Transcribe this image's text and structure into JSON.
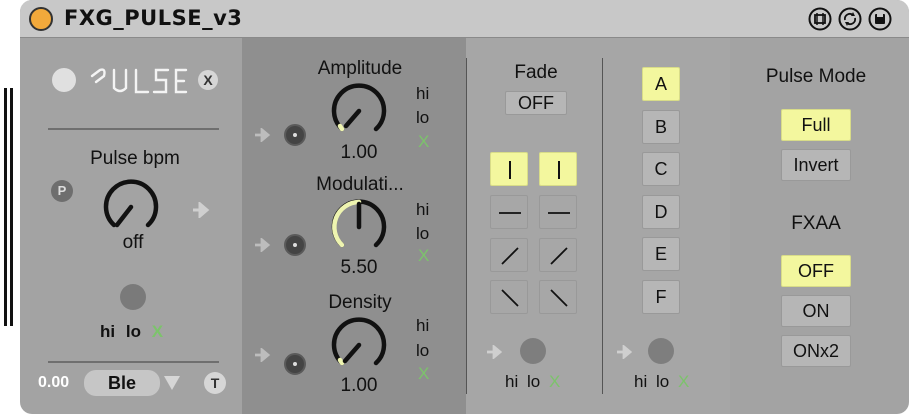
{
  "title": "FXG_PULSE_v3",
  "logo_text": "PULSE",
  "header_icons": [
    "freeze-icon",
    "reload-icon",
    "save-icon"
  ],
  "left": {
    "close_label": "X",
    "pulse_bpm_label": "Pulse bpm",
    "p_button": "P",
    "pulse_bpm_value": "off",
    "hi": "hi",
    "lo": "lo",
    "x": "X",
    "bottom_value": "0.00",
    "bottom_select": "Ble",
    "t_button": "T"
  },
  "knobs": [
    {
      "label": "Amplitude",
      "value": "1.00",
      "hi": "hi",
      "lo": "lo",
      "x": "X"
    },
    {
      "label": "Modulati...",
      "value": "5.50",
      "hi": "hi",
      "lo": "lo",
      "x": "X"
    },
    {
      "label": "Density",
      "value": "1.00",
      "hi": "hi",
      "lo": "lo",
      "x": "X"
    }
  ],
  "fade": {
    "label": "Fade",
    "value": "OFF",
    "hi": "hi",
    "lo": "lo",
    "x": "X"
  },
  "letters": {
    "items": [
      "A",
      "B",
      "C",
      "D",
      "E",
      "F"
    ],
    "selected": "A",
    "hi": "hi",
    "lo": "lo",
    "x": "X"
  },
  "pulse_mode": {
    "label": "Pulse Mode",
    "options": [
      "Full",
      "Invert"
    ],
    "selected": "Full"
  },
  "fxaa": {
    "label": "FXAA",
    "options": [
      "OFF",
      "ON",
      "ONx2"
    ],
    "selected": "OFF"
  },
  "colors": {
    "accent": "#f3f79e",
    "hilo_x": "#7cc36b",
    "orange_dot": "#f2a93b"
  }
}
